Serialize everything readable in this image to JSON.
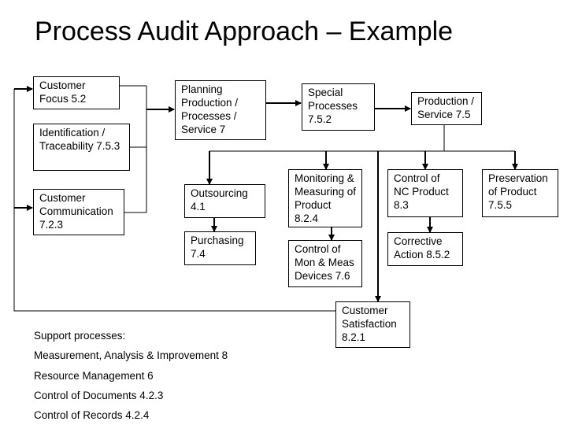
{
  "title": "Process Audit Approach – Example",
  "boxes": {
    "customer_focus": "Customer\nFocus 5.2",
    "identification": "Identification /\nTraceability 7.5.3",
    "customer_communication": "Customer\nCommunication\n7.2.3",
    "planning": "Planning\nProduction /\nProcesses /\nService 7",
    "special_processes": "Special\nProcesses\n7.5.2",
    "production_service": "Production /\nService 7.5",
    "outsourcing": "Outsourcing\n4.1",
    "purchasing": "Purchasing\n7.4",
    "monitoring": "Monitoring &\nMeasuring of\nProduct\n8.2.4",
    "control_mon_meas": "Control of\nMon & Meas\nDevices 7.6",
    "control_nc": "Control of\nNC Product\n8.3",
    "corrective_action": "Corrective\nAction 8.5.2",
    "preservation": "Preservation\nof Product\n7.5.5",
    "customer_satisfaction": "Customer\nSatisfaction\n8.2.1"
  },
  "support": {
    "heading": "Support processes:",
    "items": [
      "Measurement, Analysis & Improvement 8",
      "Resource Management 6",
      "Control of Documents 4.2.3",
      "Control of Records 4.2.4"
    ]
  }
}
